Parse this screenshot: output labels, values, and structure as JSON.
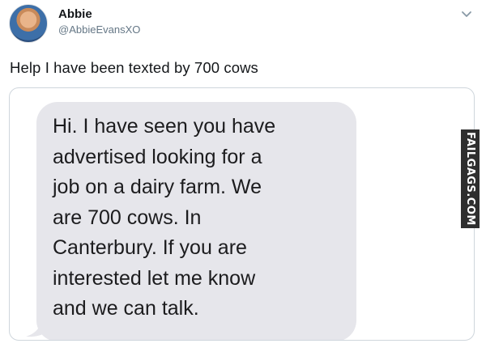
{
  "tweet": {
    "author": {
      "display_name": "Abbie",
      "handle": "@AbbieEvansXO",
      "avatar_icon": "profile-photo"
    },
    "menu_icon": "chevron-down-icon",
    "text": "Help I have been texted by 700 cows"
  },
  "screenshot": {
    "message_lines": "Hi. I have seen you have\nadvertised looking for a\njob on a dairy farm. We\nare 700 cows. In\nCanterbury. If you are\ninterested let me know\nand we can talk.",
    "bubble_color": "#e6e6eb"
  },
  "watermark": {
    "text": "FAILGAGS.COM"
  }
}
